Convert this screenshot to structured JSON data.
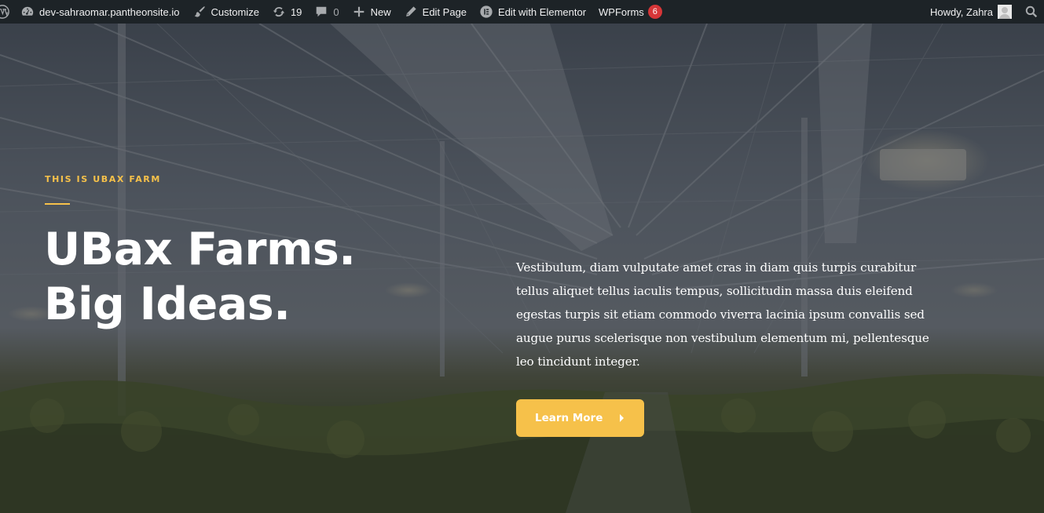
{
  "admin_bar": {
    "wp_logo_icon": "wordpress-icon",
    "site_name": "dev-sahraomar.pantheonsite.io",
    "customize": "Customize",
    "updates_count": "19",
    "comments_count": "0",
    "new": "New",
    "edit_page": "Edit Page",
    "edit_elementor": "Edit with Elementor",
    "wpforms": "WPForms",
    "wpforms_count": "6",
    "howdy": "Howdy, Zahra",
    "colors": {
      "bar_bg": "#1d2327",
      "bubble": "#d63638"
    }
  },
  "hero": {
    "eyebrow": "THIS IS UBAX FARM",
    "headline_line1": "UBax Farms.",
    "headline_line2": "Big Ideas.",
    "body": "Vestibulum, diam vulputate amet cras in diam quis turpis curabitur tellus aliquet tellus iaculis tempus, sollicitudin massa duis eleifend egestas turpis sit etiam commodo viverra lacinia ipsum convallis sed augue purus scelerisque non vestibulum elementum mi, pellentesque leo tincidunt integer.",
    "button_label": "Learn More",
    "colors": {
      "accent": "#f6c14a",
      "text": "#ffffff"
    }
  }
}
